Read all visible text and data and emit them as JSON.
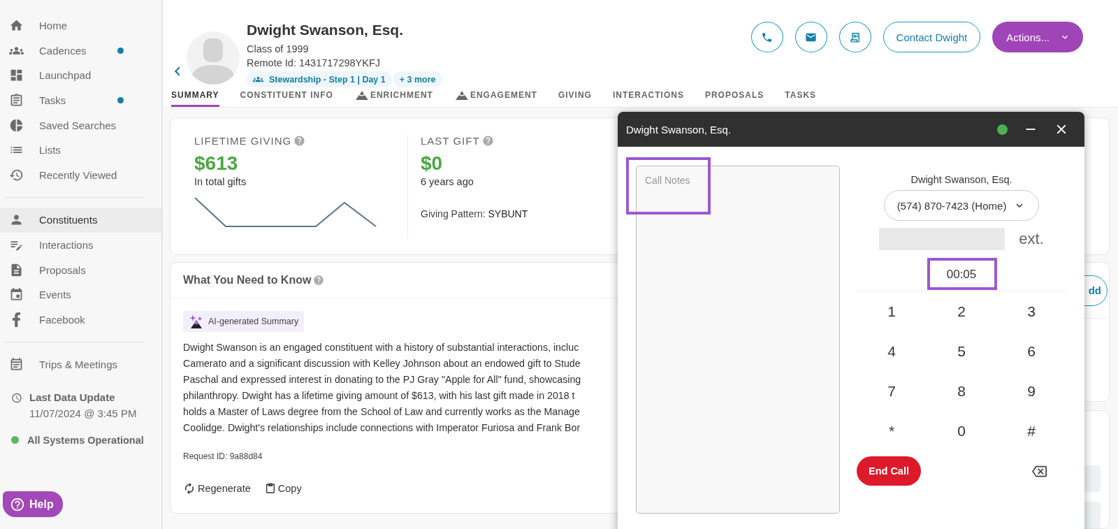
{
  "sidebar": {
    "sections": [
      {
        "items": [
          {
            "label": "Home",
            "selected": false,
            "dot": false
          },
          {
            "label": "Cadences",
            "selected": false,
            "dot": true
          },
          {
            "label": "Launchpad",
            "selected": false,
            "dot": false
          },
          {
            "label": "Tasks",
            "selected": false,
            "dot": true
          },
          {
            "label": "Saved Searches",
            "selected": false,
            "dot": false
          },
          {
            "label": "Lists",
            "selected": false,
            "dot": false
          },
          {
            "label": "Recently Viewed",
            "selected": false,
            "dot": false
          }
        ]
      },
      {
        "items": [
          {
            "label": "Constituents",
            "selected": true,
            "dot": false
          },
          {
            "label": "Interactions",
            "selected": false,
            "dot": false
          },
          {
            "label": "Proposals",
            "selected": false,
            "dot": false
          },
          {
            "label": "Events",
            "selected": false,
            "dot": false
          },
          {
            "label": "Facebook",
            "selected": false,
            "dot": false
          }
        ]
      },
      {
        "items": [
          {
            "label": "Trips & Meetings",
            "selected": false,
            "dot": false
          }
        ]
      }
    ],
    "data_update": {
      "title": "Last Data Update",
      "value": "11/07/2024 @ 3:45 PM"
    },
    "status": {
      "label": "All Systems Operational",
      "color": "#5cb85c"
    },
    "help": "Help"
  },
  "profile": {
    "name": "Dwight Swanson, Esq.",
    "class": "Class of 1999",
    "remote_id": "Remote Id: 1431717298YKFJ",
    "chips": [
      {
        "label": "Stewardship - Step 1 | Day 1",
        "kind": "cadence"
      },
      {
        "label": "+ 3 more",
        "kind": "plain"
      }
    ],
    "actions": {
      "contact": "Contact Dwight",
      "menu": "Actions..."
    }
  },
  "tabs": [
    {
      "label": "SUMMARY",
      "selected": true,
      "kind": "plain"
    },
    {
      "label": "CONSTITUENT INFO",
      "selected": false,
      "kind": "plain"
    },
    {
      "label": "ENRICHMENT",
      "selected": false,
      "kind": "flagged"
    },
    {
      "label": "ENGAGEMENT",
      "selected": false,
      "kind": "flagged"
    },
    {
      "label": "GIVING",
      "selected": false,
      "kind": "plain"
    },
    {
      "label": "INTERACTIONS",
      "selected": false,
      "kind": "plain"
    },
    {
      "label": "PROPOSALS",
      "selected": false,
      "kind": "plain"
    },
    {
      "label": "TASKS",
      "selected": false,
      "kind": "plain"
    }
  ],
  "giving": {
    "lifetime": {
      "title": "LIFETIME GIVING",
      "amount": "$613",
      "caption": "In total gifts"
    },
    "last_gift": {
      "title": "LAST GIFT",
      "amount": "$0",
      "caption": "6 years ago",
      "pattern_label": "Giving Pattern:",
      "pattern": "SYBUNT"
    }
  },
  "know": {
    "title": "What You Need to Know",
    "badge": "AI-generated Summary",
    "lines": [
      "Dwight Swanson is an engaged constituent with a history of substantial interactions, incluc",
      "Camerato and a significant discussion with Kelley Johnson about an endowed gift to Stude",
      "Paschal and expressed interest in donating to the PJ Gray \"Apple for All\" fund, showcasing",
      "philanthropy. Dwight has a lifetime giving amount of $613, with his last gift made in 2018 t",
      "holds a Master of Laws degree from the School of Law and currently works as the Manage",
      "Coolidge. Dwight's relationships include connections with Imperator Furiosa and Frank Bor"
    ],
    "request_id": "Request ID: 9a88d84",
    "regenerate": "Regenerate",
    "copy": "Copy"
  },
  "side_button": "dd",
  "call": {
    "title": "Dwight Swanson, Esq.",
    "connected": true,
    "notes": {
      "placeholder": "Call Notes",
      "highlighted": true
    },
    "contact": "Dwight Swanson, Esq.",
    "phone": "(574) 870-7423 (Home)",
    "ext": "ext.",
    "timer": {
      "value": "00:05",
      "highlighted": true
    },
    "keys": [
      "1",
      "2",
      "3",
      "4",
      "5",
      "6",
      "7",
      "8",
      "9",
      "*",
      "0",
      "#"
    ],
    "end": "End Call"
  }
}
